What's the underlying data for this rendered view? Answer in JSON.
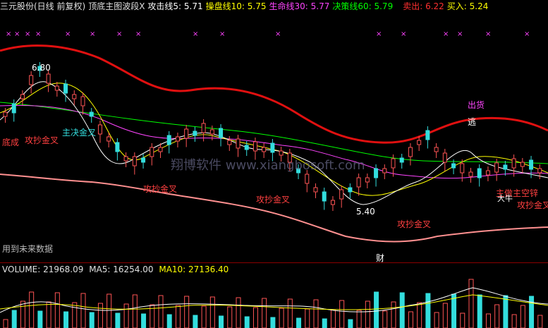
{
  "header": {
    "title": "三元股份(日线 前复权)",
    "indicator": "顶底主图波段X",
    "ma5": "攻击线5: 5.71",
    "ma10": "操盘线10: 5.75",
    "ma30": "生命线30: 5.77",
    "ma60": "决策线60: 5.79",
    "sell": "卖出: 6.22",
    "buy": "买入: 5.24"
  },
  "colors": {
    "ma5": "#ffffff",
    "ma10": "#ffff00",
    "ma30": "#ff44ff",
    "ma60": "#00ff00",
    "sell": "#ff3030",
    "buy": "#ffff00",
    "up": "#ff5555",
    "down": "#33dddd",
    "upper_band": "#e01010",
    "lower_band": "#ff9090"
  },
  "annotations": {
    "high_price": "6.80",
    "low_price": "5.40",
    "bottom_done": "底成",
    "golden_cross": "攻抄金叉",
    "main_golden": "主决金叉",
    "ship_out": "出货",
    "escape": "逃",
    "main_short": "主做主空锌",
    "big_rise": "大牛",
    "watermark": "翔博软件 www.xiangbosoft.com",
    "future_data": "用到未来数据",
    "finance": "财"
  },
  "volume_header": {
    "volume": "VOLUME: 21968.09",
    "ma5": "MA5: 16254.00",
    "ma10": "MA10: 27136.40"
  }
}
